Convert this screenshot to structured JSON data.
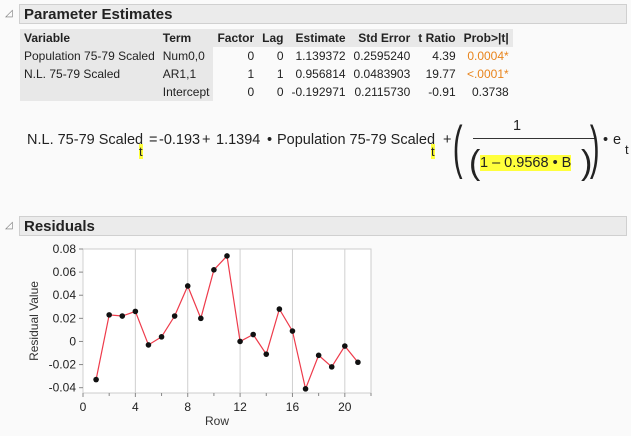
{
  "param": {
    "title": "Parameter Estimates",
    "headers": [
      "Variable",
      "Term",
      "Factor",
      "Lag",
      "Estimate",
      "Std Error",
      "t Ratio",
      "Prob>|t|"
    ],
    "rows": [
      [
        "Population 75-79 Scaled",
        "Num0,0",
        "0",
        "0",
        "1.139372",
        "0.2595240",
        "4.39",
        "0.0004*"
      ],
      [
        "N.L. 75-79 Scaled",
        "AR1,1",
        "1",
        "1",
        "0.956814",
        "0.0483903",
        "19.77",
        "<.0001*"
      ],
      [
        "",
        "Intercept",
        "0",
        "0",
        "-0.192971",
        "0.2115730",
        "-0.91",
        "0.3738"
      ]
    ]
  },
  "equation": {
    "lhs": "N.L. 75-79 Scaled",
    "sub": "t",
    "eq_sign": "=",
    "const": "-0.193",
    "plus": "+",
    "coef": "1.1394",
    "dot": "•",
    "var": "Population 75-79 Scaled",
    "num": "1",
    "den": "1 – 0.9568 • B",
    "err": "e"
  },
  "residuals": {
    "title": "Residuals"
  },
  "chart_data": {
    "type": "line",
    "xlabel": "Row",
    "ylabel": "Residual Value",
    "xlim": [
      0,
      22
    ],
    "ylim": [
      -0.0446,
      0.08
    ],
    "xticks": [
      "0",
      "4",
      "8",
      "12",
      "16",
      "20"
    ],
    "yticks": [
      "0.08",
      "0.06",
      "0.04",
      "0.02",
      "0",
      "-0.02",
      "-0.04"
    ],
    "x": [
      1,
      2,
      3,
      4,
      5,
      6,
      7,
      8,
      9,
      10,
      11,
      12,
      13,
      14,
      15,
      16,
      17,
      18,
      19,
      20,
      21
    ],
    "y": [
      -0.033,
      0.023,
      0.022,
      0.026,
      -0.003,
      0.004,
      0.022,
      0.048,
      0.02,
      0.062,
      0.074,
      0.0,
      0.006,
      -0.011,
      0.028,
      0.009,
      -0.041,
      -0.012,
      -0.022,
      -0.004,
      -0.018
    ],
    "line_color": "#ee3b4b",
    "marker_color": "#111111"
  }
}
